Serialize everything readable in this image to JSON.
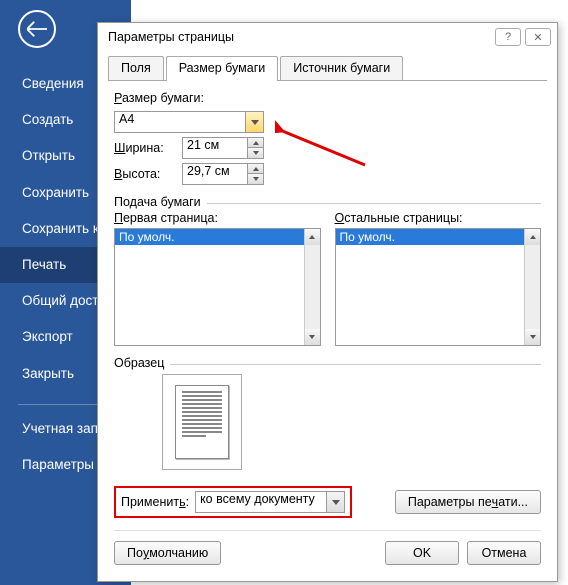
{
  "sidebar": {
    "items": [
      {
        "label": "Сведения"
      },
      {
        "label": "Создать"
      },
      {
        "label": "Открыть"
      },
      {
        "label": "Сохранить"
      },
      {
        "label": "Сохранить как"
      },
      {
        "label": "Печать"
      },
      {
        "label": "Общий доступ"
      },
      {
        "label": "Экспорт"
      },
      {
        "label": "Закрыть"
      }
    ],
    "account": "Учетная запись",
    "options": "Параметры"
  },
  "dialog": {
    "title": "Параметры страницы",
    "help": "?",
    "close": "✕",
    "tabs": {
      "fields": "Поля",
      "paper_size": "Размер бумаги",
      "source": "Источник бумаги"
    },
    "paper": {
      "label": "Размер бумаги:",
      "value": "A4",
      "width_label": "Ширина:",
      "width_value": "21 см",
      "height_label": "Высота:",
      "height_value": "29,7 см"
    },
    "feed": {
      "title": "Подача бумаги",
      "first_label": "Первая страница:",
      "other_label": "Остальные страницы:",
      "default_option": "По умолч."
    },
    "preview_title": "Образец",
    "apply_label": "Применить:",
    "apply_value": "ко всему документу",
    "print_params": "Параметры печати...",
    "default_btn": "По умолчанию",
    "ok": "OK",
    "cancel": "Отмена"
  }
}
